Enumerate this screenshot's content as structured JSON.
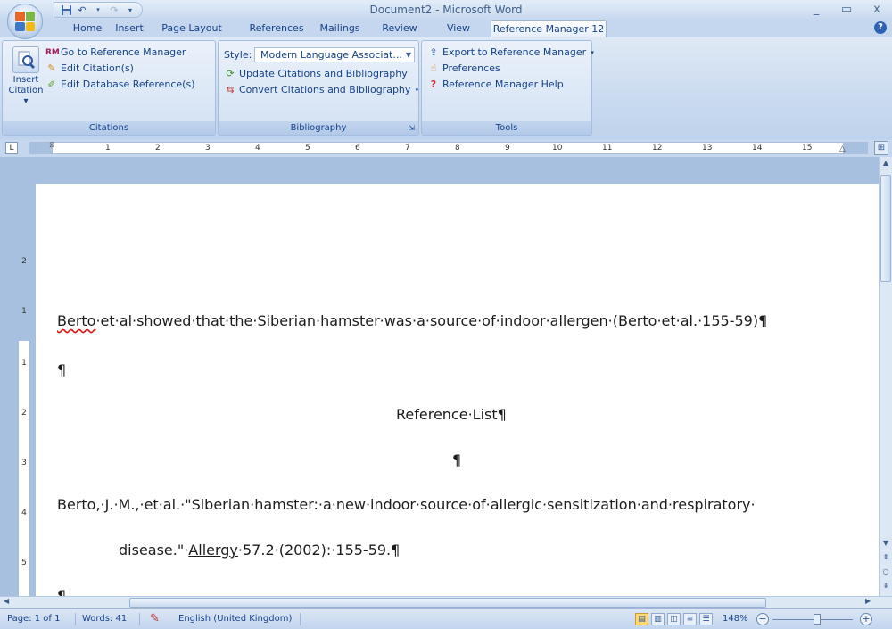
{
  "window": {
    "title": "Document2 - Microsoft Word",
    "minimize": "_",
    "maximize": "▭",
    "close": "x"
  },
  "qat": {
    "save_icon": "save-icon",
    "undo_icon": "undo-icon",
    "redo_icon": "redo-icon",
    "customize_icon": "customize-icon"
  },
  "tabs": [
    "Home",
    "Insert",
    "Page Layout",
    "References",
    "Mailings",
    "Review",
    "View",
    "Reference Manager 12"
  ],
  "active_tab": "Reference Manager 12",
  "ribbon": {
    "citations": {
      "label": "Citations",
      "insert_citation": "Insert Citation",
      "insert_line1": "Insert",
      "insert_line2": "Citation ▾",
      "go_to_rm": "Go to Reference Manager",
      "edit_citations": "Edit Citation(s)",
      "edit_db_refs": "Edit Database Reference(s)"
    },
    "bibliography": {
      "label": "Bibliography",
      "style_label": "Style:",
      "style_value": "Modern Language Associat...",
      "update": "Update Citations and Bibliography",
      "convert": "Convert Citations and Bibliography"
    },
    "tools": {
      "label": "Tools",
      "export": "Export to Reference Manager",
      "preferences": "Preferences",
      "help": "Reference Manager Help"
    }
  },
  "ruler": {
    "numbers": [
      "1",
      "2",
      "3",
      "4",
      "5",
      "6",
      "7",
      "8",
      "9",
      "10",
      "11",
      "12",
      "13",
      "14",
      "15"
    ],
    "vnumbers": [
      "2",
      "1",
      "1",
      "2",
      "3",
      "4",
      "5"
    ]
  },
  "document": {
    "line1_a": "Berto",
    "line1_b": "·et·al·showed·that·the·Siberian·hamster·was·a·source·of·indoor·allergen·(Berto·et·al.·155-59)¶",
    "line2": "¶",
    "line3": "Reference·List¶",
    "line4": "¶",
    "line5": "Berto,·J.·M.,·et·al.·\"Siberian·hamster:·a·new·indoor·source·of·allergic·sensitization·and·respiratory·",
    "line6_a": "disease.\"·",
    "line6_b": "Allergy",
    "line6_c": "·57.2·(2002):·155-59.¶",
    "line7": "¶"
  },
  "status": {
    "page": "Page: 1 of 1",
    "words": "Words: 41",
    "language": "English (United Kingdom)",
    "zoom": "148%",
    "zoom_out": "−",
    "zoom_in": "+"
  },
  "colors": {
    "ribbon_bg": "#c7d9ef",
    "text_blue": "#15428b",
    "accent_orange": "#fcd774"
  }
}
